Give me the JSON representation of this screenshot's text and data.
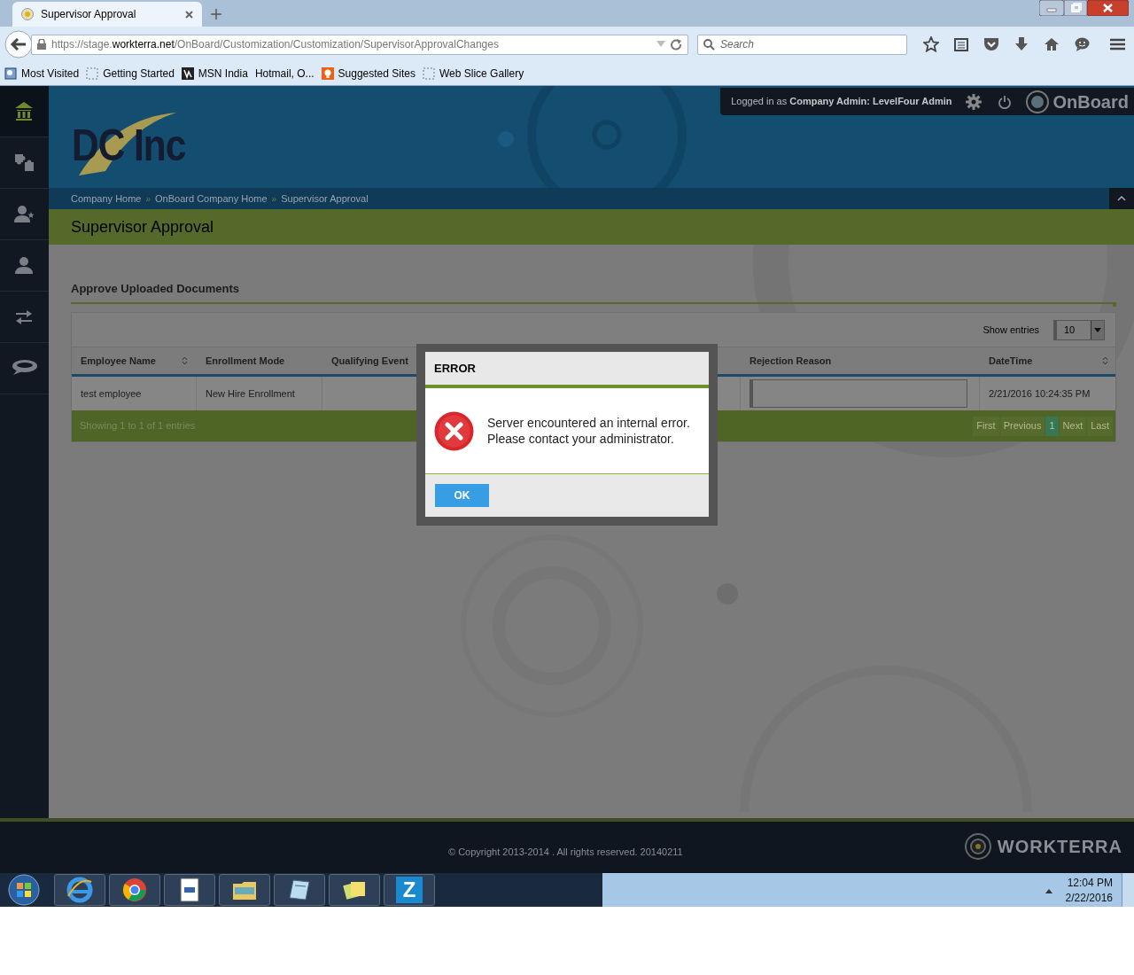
{
  "browser": {
    "tab_title": "Supervisor Approval",
    "url_prefix": "https://stage.",
    "url_domain": "workterra.net",
    "url_path": "/OnBoard/Customization/Customization/SupervisorApprovalChanges",
    "search_placeholder": "Search",
    "bookmarks": [
      "Most Visited",
      "Getting Started",
      "MSN India",
      "Hotmail, O...",
      "Suggested Sites",
      "Web Slice Gallery"
    ]
  },
  "sidebar": {
    "items": [
      {
        "kind": "home",
        "selected": true
      },
      {
        "kind": "puzzle",
        "selected": false
      },
      {
        "kind": "user-star",
        "selected": false
      },
      {
        "kind": "user",
        "selected": false
      },
      {
        "kind": "swap",
        "selected": false
      },
      {
        "kind": "chat",
        "selected": false
      }
    ]
  },
  "header": {
    "logo_text": "DC Inc",
    "logged_in_prefix": "Logged in as",
    "user_role": "Company Admin:",
    "user_name": "LevelFour Admin",
    "brand": "OnBoard"
  },
  "breadcrumb": [
    "Company Home",
    "OnBoard Company Home",
    "Supervisor Approval"
  ],
  "breadcrumb_separator": "»",
  "page_title": "Supervisor Approval",
  "section_title": "Approve Uploaded Documents",
  "table": {
    "show_entries_label": "Show entries",
    "page_size": "10",
    "columns": [
      {
        "label": "Employee Name",
        "sortable": true
      },
      {
        "label": "Enrollment Mode",
        "sortable": false
      },
      {
        "label": "Qualifying Event",
        "sortable": false
      },
      {
        "label": "Rejection Reason",
        "sortable": false
      },
      {
        "label": "DateTime",
        "sortable": true
      }
    ],
    "rows": [
      {
        "employee_name": "test employee",
        "enrollment_mode": "New Hire Enrollment",
        "datetime": "2/21/2016 10:24:35 PM"
      }
    ],
    "info": "Showing 1 to 1 of 1 entries",
    "pagination": [
      {
        "label": "First",
        "selected": false
      },
      {
        "label": "Previous",
        "selected": false
      },
      {
        "label": "1",
        "selected": true
      },
      {
        "label": "Next",
        "selected": false
      },
      {
        "label": "Last",
        "selected": false
      }
    ]
  },
  "dialog": {
    "title": "ERROR",
    "message": [
      "Server encountered an internal error.",
      "Please contact your administrator."
    ],
    "button": "OK"
  },
  "footer": {
    "copyright": "© Copyright 2013-2014 . All rights reserved. 20140211",
    "brand": "WORKTERRA"
  },
  "taskbar": {
    "tile_letter": "Z",
    "time": "12:04 PM",
    "date": "2/22/2016"
  }
}
